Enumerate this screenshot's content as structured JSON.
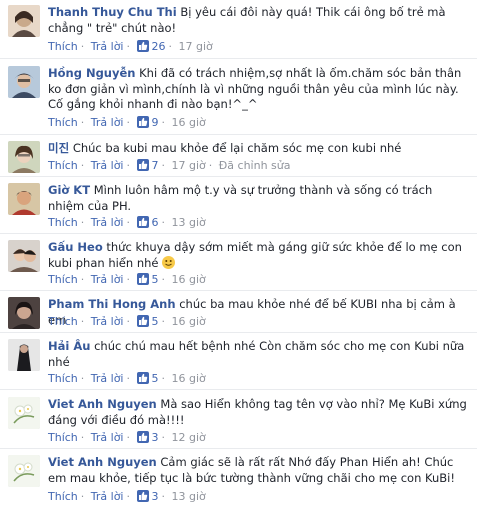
{
  "actions": {
    "like": "Thích",
    "reply": "Trả lời"
  },
  "comments": [
    {
      "name": "Thanh Thuy Chu Thi",
      "text": "Bị yêu cái đôi này quá! Thik cái ông bố trẻ mà chẳng \" trẻ\" chút nào!",
      "likes": "26",
      "time": "17 giờ",
      "avatar_color": "#c9a98b"
    },
    {
      "name": "Hồng Nguyễn",
      "text": "Khi đã có trách nhiệm,sợ nhất là ốm.chăm sóc bản thân ko đơn giản vì mình,chính là vì những nguồi thân yêu của mình lúc này. Cố gắng khỏi nhanh đi nào bạn!^_^",
      "likes": "9",
      "time": "16 giờ",
      "avatar_color": "#8fa7bf"
    },
    {
      "name": "미진",
      "text": "Chúc ba kubi mau khỏe để lại chăm sóc mẹ con kubi nhé",
      "likes": "7",
      "time": "17 giờ",
      "extra": "Đã chỉnh sửa",
      "avatar_color": "#b8c0a0"
    },
    {
      "name": "Giờ KT",
      "text": "Mình luôn hâm mộ t.y và sự trưởng thành và sống có trách nhiệm của PH.",
      "likes": "6",
      "time": "13 giờ",
      "avatar_color": "#c2a27a"
    },
    {
      "name": "Gấu Heo",
      "text": "thức khuya dậy sớm miết mà gáng giữ sức khỏe để lo mẹ con kubi phan hiển nhé",
      "likes": "5",
      "time": "16 giờ",
      "avatar_color": "#d8b49a"
    },
    {
      "name": "Pham Thi Hong Anh",
      "text": "chúc ba mau khỏe nhé để bế KUBI nha bị cảm à em",
      "likes": "5",
      "time": "16 giờ",
      "avatar_color": "#7b6a62"
    },
    {
      "name": "Hải Âu",
      "text": "chúc chú mau hết bệnh nhé Còn chăm sóc cho mẹ con Kubi nữa nhé",
      "likes": "5",
      "time": "16 giờ",
      "avatar_color": "#44474c"
    },
    {
      "name": "Viet Anh Nguyen",
      "text": "Mà sao Hiển không tag tên vợ vào nhỉ? Mẹ KuBi xứng đáng với điều đó mà!!!!",
      "likes": "3",
      "time": "12 giờ",
      "avatar_color": "#e9efe4"
    },
    {
      "name": "Viet Anh Nguyen",
      "text": "Cảm giác sẽ là rất rất Nhớ đấy Phan Hiển ah! Chúc em mau khỏe, tiếp tục là bức tường thành vững chãi cho mẹ con KuBi!",
      "likes": "3",
      "time": "13 giờ",
      "avatar_color": "#e9efe4"
    }
  ]
}
